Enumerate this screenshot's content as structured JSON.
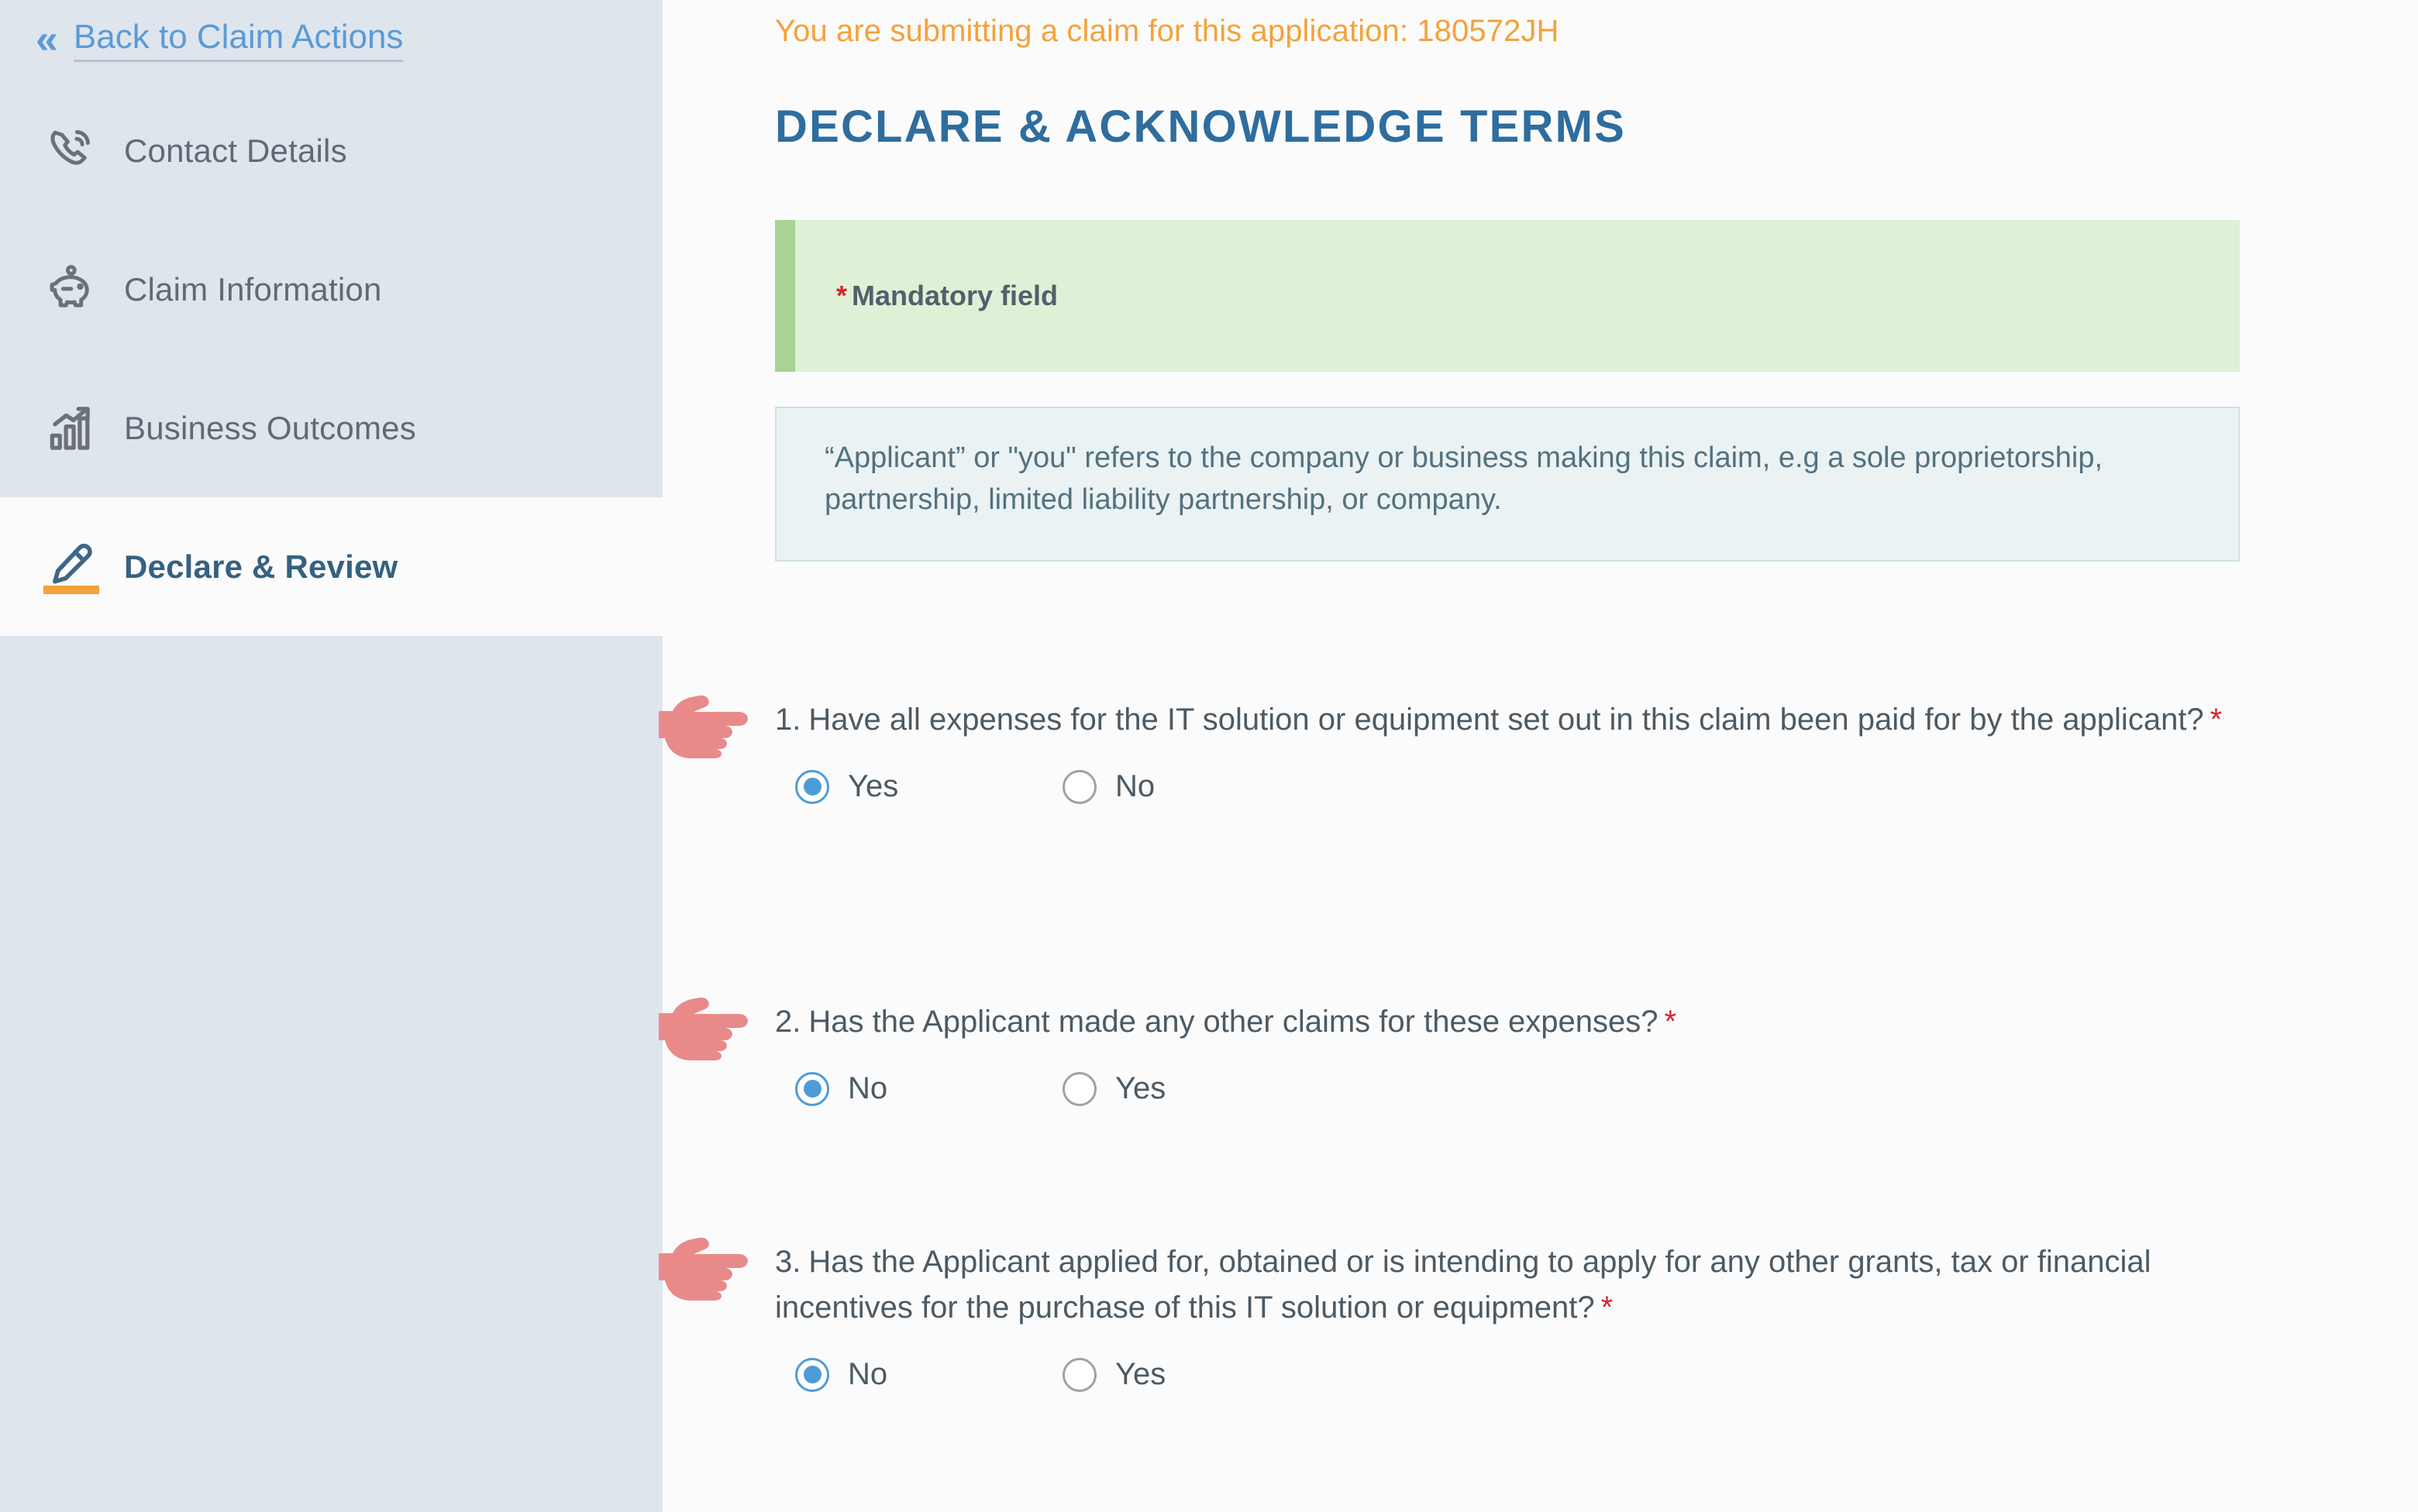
{
  "sidebar": {
    "back_link": {
      "label": "Back to Claim Actions",
      "icon": "double-chevron-left-icon"
    },
    "items": [
      {
        "label": "Contact Details",
        "icon": "phone-ring-icon",
        "active": false
      },
      {
        "label": "Claim Information",
        "icon": "piggy-bank-icon",
        "active": false
      },
      {
        "label": "Business Outcomes",
        "icon": "bar-chart-up-icon",
        "active": false
      },
      {
        "label": "Declare & Review",
        "icon": "signature-pen-icon",
        "active": true
      }
    ]
  },
  "main": {
    "application_banner": "You are submitting a claim for this application: 180572JH",
    "application_id": "180572JH",
    "page_title": "DECLARE & ACKNOWLEDGE TERMS",
    "mandatory_notice": {
      "star": "*",
      "label": "Mandatory field"
    },
    "definition_note": "“Applicant” or \"you\" refers to the company or business making this claim, e.g a sole proprietorship, partnership, limited liability partnership, or company.",
    "questions": [
      {
        "number": "1.",
        "text": "Have all expenses for the IT solution or equipment set out in this claim been paid for by the applicant?",
        "required_marker": "*",
        "pointer_icon": "pointing-hand-right-icon",
        "options": [
          {
            "label": "Yes",
            "selected": true
          },
          {
            "label": "No",
            "selected": false
          }
        ]
      },
      {
        "number": "2.",
        "text": "Has the Applicant made any other claims for these expenses?",
        "required_marker": "*",
        "pointer_icon": "pointing-hand-right-icon",
        "options": [
          {
            "label": "No",
            "selected": true
          },
          {
            "label": "Yes",
            "selected": false
          }
        ]
      },
      {
        "number": "3.",
        "text": "Has the Applicant applied for, obtained or is intending to apply for any other grants, tax or financial incentives for the purchase of this IT solution or equipment?",
        "required_marker": "*",
        "pointer_icon": "pointing-hand-right-icon",
        "options": [
          {
            "label": "No",
            "selected": true
          },
          {
            "label": "Yes",
            "selected": false
          }
        ]
      }
    ]
  },
  "colors": {
    "sidebar_bg": "#dfe5ed",
    "content_bg": "#fbfbfc",
    "link_blue": "#5b9bd5",
    "title_blue": "#2e6d9e",
    "accent_orange": "#f4a23a",
    "mandatory_green_bg": "#dff0d6",
    "mandatory_green_border": "#a8d394",
    "info_blue_bg": "#eaf2f4",
    "info_blue_border": "#cfe0e6",
    "required_red": "#d5262b",
    "radio_selected": "#4e9cd6",
    "pointer_pink": "#e88a8a"
  }
}
